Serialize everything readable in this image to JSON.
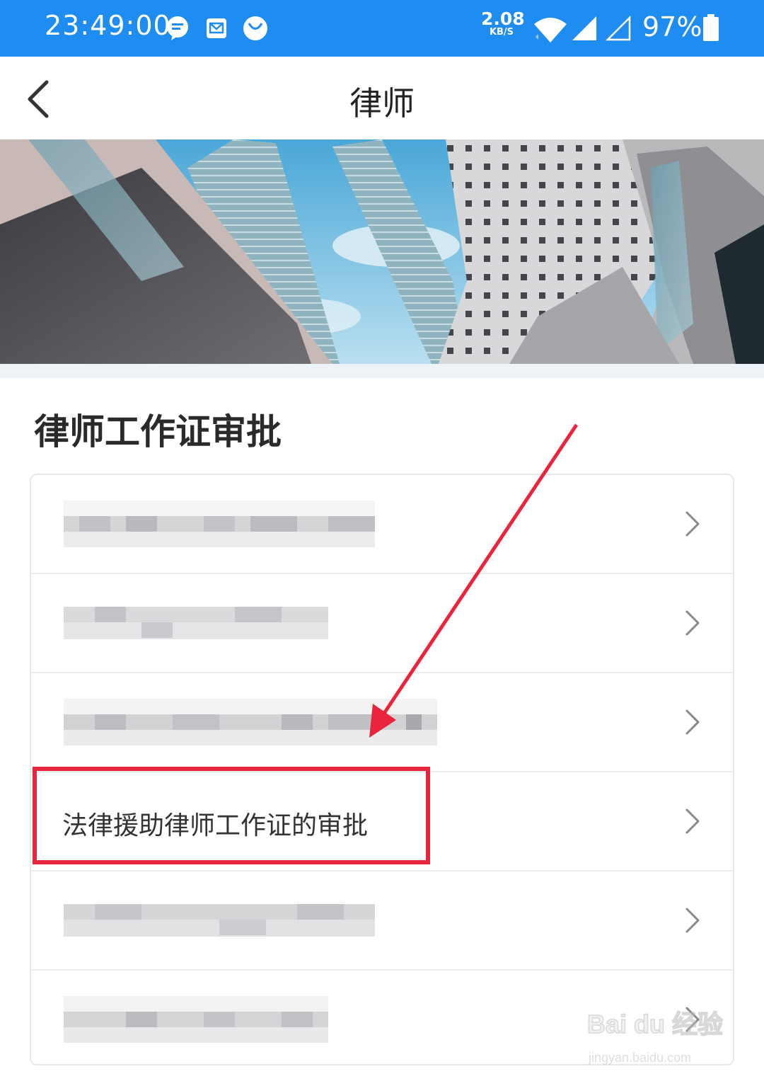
{
  "status_bar": {
    "time": "23:49:00",
    "net_speed": "2.08",
    "net_speed_unit": "KB/S",
    "battery": "97%",
    "icons": [
      "chat-icon",
      "mail-icon",
      "smile-icon",
      "wifi-icon",
      "signal-icon",
      "signal-empty-icon",
      "battery-icon"
    ]
  },
  "nav": {
    "title": "律师",
    "back_icon": "chevron-left-icon"
  },
  "banner": {
    "description_icon": "banner-image"
  },
  "section": {
    "title": "律师工作证审批"
  },
  "list": {
    "items": [
      {
        "label": "",
        "blurred": true
      },
      {
        "label": "",
        "blurred": true
      },
      {
        "label": "",
        "blurred": true
      },
      {
        "label": "法律援助律师工作证的审批",
        "blurred": false,
        "highlighted": true
      },
      {
        "label": "",
        "blurred": true
      },
      {
        "label": "",
        "blurred": true
      }
    ]
  },
  "watermark": {
    "logo": "Bai du 经验",
    "url": "jingyan.baidu.com"
  },
  "colors": {
    "status_bar": "#1e8cf0",
    "highlight": "#e8253c",
    "divider": "#ececec"
  }
}
